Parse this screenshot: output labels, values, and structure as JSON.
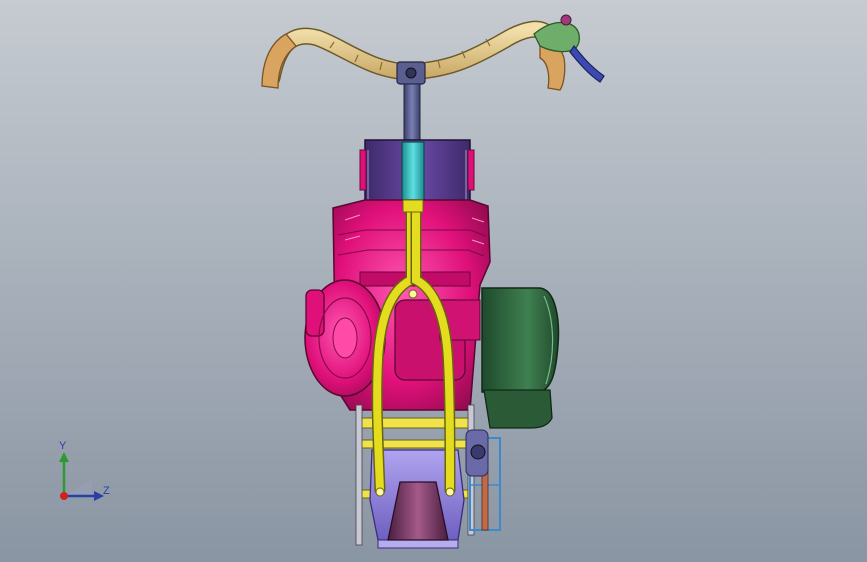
{
  "viewport": {
    "background_top": "#c6cbd1",
    "background_bottom": "#8a95a3"
  },
  "model": {
    "parts": {
      "handlebar": {
        "color": "#e7cf96"
      },
      "grips": {
        "color": "#d9a45f"
      },
      "brake_lever": {
        "color": "#6fae6a"
      },
      "stem": {
        "color": "#545a8c"
      },
      "head_tube": {
        "color": "#37c1c2"
      },
      "fuel_tank": {
        "color": "#5a3e8e"
      },
      "engine": {
        "color": "#e0107a"
      },
      "fork": {
        "color": "#e4dd1f"
      },
      "air_filter": {
        "color": "#2f6a3f"
      },
      "frame_rails": {
        "color": "#f0e24a"
      },
      "lower_guard": {
        "color": "#8f7fd8"
      },
      "skid_plate": {
        "color": "#6a2f5a"
      },
      "chain_bracket": {
        "color": "#3a8ad0"
      }
    }
  },
  "triad": {
    "y_label": "Y",
    "z_label": "Z",
    "y_color": "#2e9a2e",
    "z_color": "#2a3ea8",
    "x_color": "#d22020"
  }
}
